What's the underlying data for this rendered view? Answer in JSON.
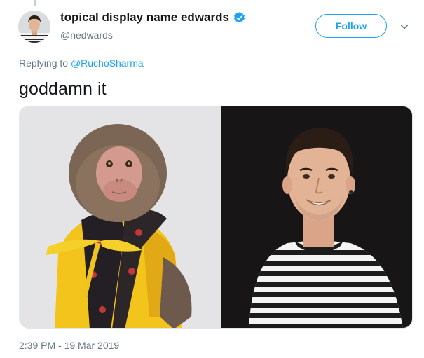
{
  "tweet": {
    "display_name": "topical display name edwards",
    "handle": "@nedwards",
    "follow_label": "Follow",
    "replying_prefix": "Replying to",
    "replying_to": "@RuchoSharma",
    "text": "goddamn it",
    "timestamp": "2:39 PM - 19 Mar 2019",
    "verified": true
  },
  "media": {
    "left_image": "monkey-in-yellow-kimono",
    "right_image": "man-in-striped-shirt"
  },
  "icons": {
    "verified": "verified-badge-icon",
    "caret": "chevron-down-icon"
  },
  "colors": {
    "brand_blue": "#1da1f2",
    "secondary_text": "#657786",
    "primary_text": "#14171a"
  }
}
